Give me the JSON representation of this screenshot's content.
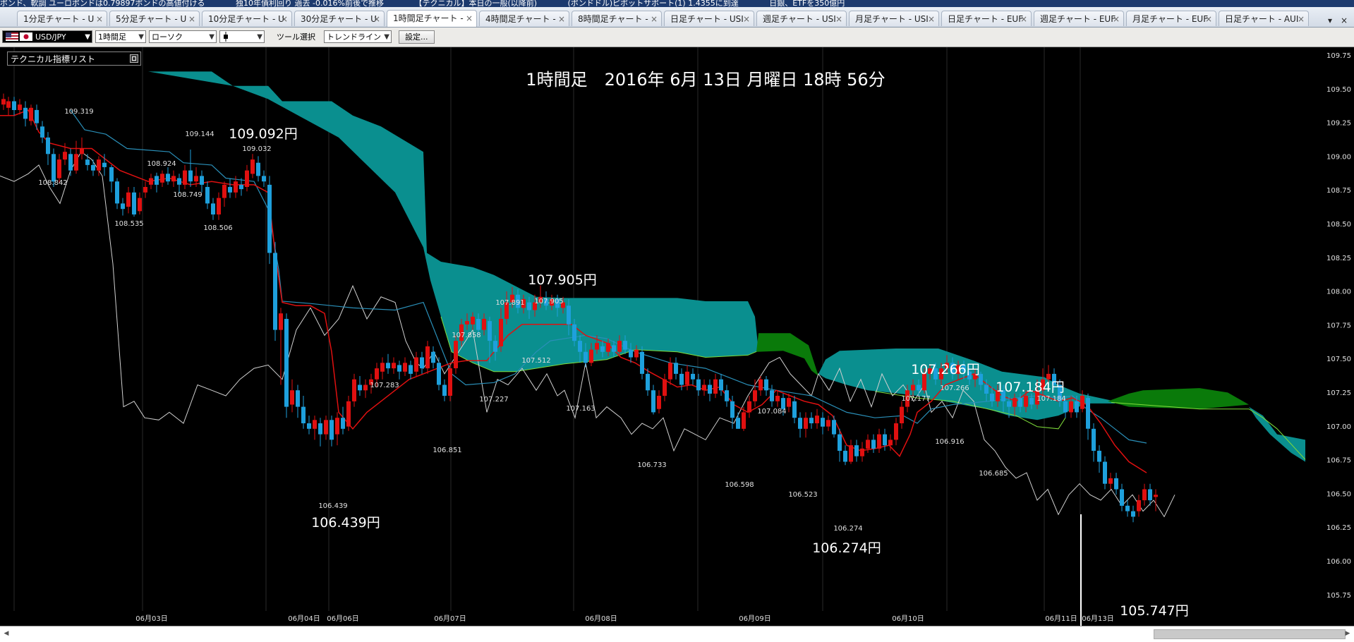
{
  "ticker": [
    "ポンド、軟調 ユーロポンドは0.79897ポンドの高値付ける",
    "独10年債利回り 過去 -0.016%前後で推移",
    "【テクニカル】本日の一般(以降前)",
    "(ポンドドル)ピボットサポート(1) 1.4355に到達",
    "日銀、ETFを350億円"
  ],
  "tabs": [
    {
      "label": "1分足チャート - U",
      "active": false
    },
    {
      "label": "5分足チャート - U",
      "active": false
    },
    {
      "label": "10分足チャート - U",
      "active": false
    },
    {
      "label": "30分足チャート - U",
      "active": false
    },
    {
      "label": "1時間足チャート -",
      "active": true
    },
    {
      "label": "4時間足チャート -",
      "active": false
    },
    {
      "label": "8時間足チャート -",
      "active": false
    },
    {
      "label": "日足チャート - USI",
      "active": false
    },
    {
      "label": "週足チャート - USI",
      "active": false
    },
    {
      "label": "月足チャート - USI",
      "active": false
    },
    {
      "label": "日足チャート - EUF",
      "active": false
    },
    {
      "label": "週足チャート - EUF",
      "active": false
    },
    {
      "label": "月足チャート - EUF",
      "active": false
    },
    {
      "label": "日足チャート - AUI",
      "active": false
    }
  ],
  "tab_close": "×",
  "tab_menu": "▾",
  "tab_close_all": "×",
  "toolbar": {
    "symbol": "USD/JPY",
    "timeframe": "1時間足",
    "chart_type": "ローソク",
    "tool_label": "ツール選択",
    "tool_value": "トレンドライン",
    "settings_button": "設定..."
  },
  "tech_panel_label": "テクニカル指標リスト",
  "chart_data": {
    "type": "candlestick",
    "title": "1時間足　2016年 6月 13日 月曜日 18時 56分",
    "ylim": [
      105.6,
      109.85
    ],
    "y_ticks": [
      "109.75",
      "109.50",
      "109.25",
      "109.00",
      "108.75",
      "108.50",
      "108.25",
      "108.00",
      "107.75",
      "107.50",
      "107.25",
      "107.00",
      "106.75",
      "106.50",
      "106.25",
      "106.00",
      "105.75"
    ],
    "x_ticks": [
      "06月03日",
      "06月04日",
      "06月06日",
      "06月07日",
      "06月08日",
      "06月09日",
      "06月10日",
      "06月11日",
      "06月13日"
    ],
    "big_labels": [
      {
        "text": "109.092円"
      },
      {
        "text": "106.439円"
      },
      {
        "text": "107.905円"
      },
      {
        "text": "107.266円"
      },
      {
        "text": "107.184円"
      },
      {
        "text": "106.274円"
      },
      {
        "text": "105.747円"
      }
    ],
    "small_labels": [
      "109.319",
      "108.842",
      "109.144",
      "108.924",
      "108.749",
      "108.535",
      "108.506",
      "109.032",
      "106.439",
      "107.283",
      "106.851",
      "107.858",
      "107.891",
      "107.905",
      "107.512",
      "107.227",
      "107.163",
      "106.733",
      "107.084",
      "106.598",
      "106.523",
      "106.274",
      "107.177",
      "107.266",
      "106.916",
      "106.685",
      "107.184"
    ],
    "series": [
      {
        "name": "",
        "type": "candles",
        "colors": {
          "up": "#e01010",
          "down": "#1ea0dc"
        }
      },
      {
        "name": "",
        "color": "#e01010"
      },
      {
        "name": "",
        "color": "#2a8fb8"
      },
      {
        "name": "",
        "color": "#d0d0d0"
      },
      {
        "name": "",
        "colors": {
          "bull": "#0a8f8f",
          "bear": "#0a7a0a"
        }
      }
    ]
  }
}
